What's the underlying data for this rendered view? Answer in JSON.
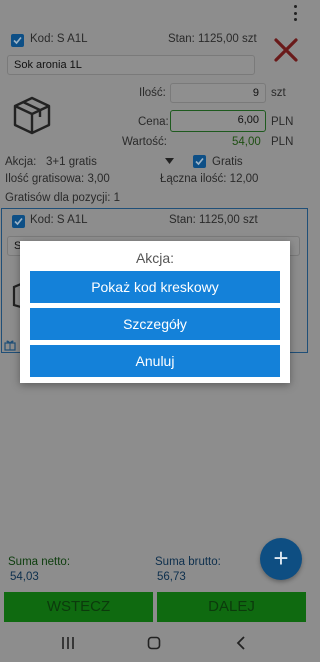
{
  "status": {
    "menu_icon": "kebab-menu-icon"
  },
  "item1": {
    "code": "Kod: S A1L",
    "stock": "Stan: 1125,00 szt",
    "name": "Sok aronia 1L",
    "quantity_label": "Ilość:",
    "quantity_value": "9",
    "quantity_unit": "szt",
    "price_label": "Cena:",
    "price_value": "6,00",
    "price_unit": "PLN",
    "value_label": "Wartość:",
    "value_value": "54,00",
    "value_unit": "PLN",
    "action_label": "Akcja:",
    "action_value": "3+1 gratis",
    "gratis_label": "Gratis",
    "free_qty": "Ilość gratisowa: 3,00",
    "total_qty": "Łączna ilość: 12,00",
    "free_per_position": "Gratisów dla pozycji: 1"
  },
  "item2": {
    "code": "Kod: S A1L",
    "stock": "Stan: 1125,00 szt",
    "name_partial": "S"
  },
  "dialog": {
    "title": "Akcja:",
    "buttons": [
      "Pokaż kod kreskowy",
      "Szczegóły",
      "Anuluj"
    ]
  },
  "totals": {
    "net_label": "Suma netto:",
    "net_value": "54,03",
    "gross_label": "Suma brutto:",
    "gross_value": "56,73"
  },
  "footer": {
    "back": "WSTECZ",
    "next": "DALEJ"
  },
  "colors": {
    "accent": "#1481d9",
    "green": "#0f6a10",
    "dim": "#8d8d8d"
  }
}
